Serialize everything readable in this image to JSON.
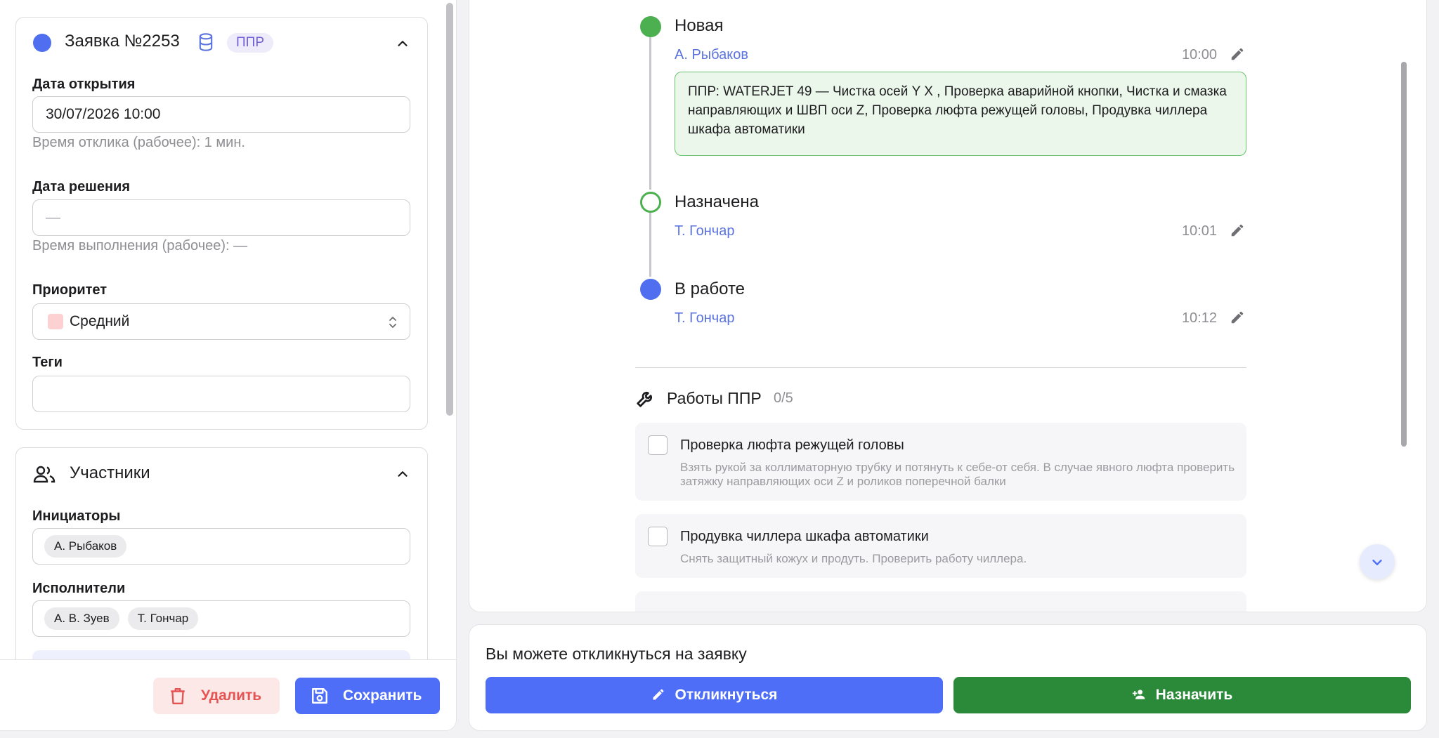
{
  "ticket": {
    "title": "Заявка №2253",
    "badge": "ППР",
    "status_color": "#506ff0",
    "fields": {
      "open_date_label": "Дата открытия",
      "open_date_value": "30/07/2026 10:00",
      "response_time": "Время отклика (рабочее): 1 мин.",
      "solve_date_label": "Дата решения",
      "solve_date_value": "—",
      "exec_time": "Время выполнения (рабочее): —",
      "priority_label": "Приоритет",
      "priority_value": "Средний",
      "priority_color": "#fdd0d2",
      "tags_label": "Теги",
      "tags_value": ""
    }
  },
  "participants": {
    "title": "Участники",
    "initiators_label": "Инициаторы",
    "initiators": [
      "А. Рыбаков"
    ],
    "executors_label": "Исполнители",
    "executors": [
      "А. В. Зуев",
      "Т. Гончар"
    ]
  },
  "footer": {
    "delete_label": "Удалить",
    "save_label": "Сохранить"
  },
  "timeline": [
    {
      "status": "Новая",
      "author": "А. Рыбаков",
      "time": "10:00",
      "note": "ППР: WATERJET 49 — Чистка осей Y X , Проверка аварийной кнопки, Чистка и смазка направляющих и ШВП оси Z, Проверка люфта режущей головы, Продувка чиллера шкафа автоматики",
      "dot": "filled-green"
    },
    {
      "status": "Назначена",
      "author": "Т. Гончар",
      "time": "10:01",
      "dot": "outline-green"
    },
    {
      "status": "В работе",
      "author": "Т. Гончар",
      "time": "10:12",
      "dot": "filled-blue"
    }
  ],
  "works": {
    "title": "Работы ППР",
    "count": "0/5",
    "tasks": [
      {
        "title": "Проверка люфта режущей головы",
        "desc": "Взять рукой за коллиматорную трубку и потянуть к себе-от себя. В случае явного люфта проверить затяжку направляющих оси Z и роликов поперечной балки",
        "done": false
      },
      {
        "title": "Продувка чиллера шкафа автоматики",
        "desc": "Снять защитный кожух и продуть. Проверить работу чиллера.",
        "done": false
      }
    ]
  },
  "respond": {
    "text": "Вы можете откликнуться на заявку",
    "respond_label": "Откликнуться",
    "assign_label": "Назначить"
  },
  "colors": {
    "accent_blue": "#4f6ef7",
    "accent_green": "#2a8a3a",
    "success_green": "#4caf50"
  }
}
